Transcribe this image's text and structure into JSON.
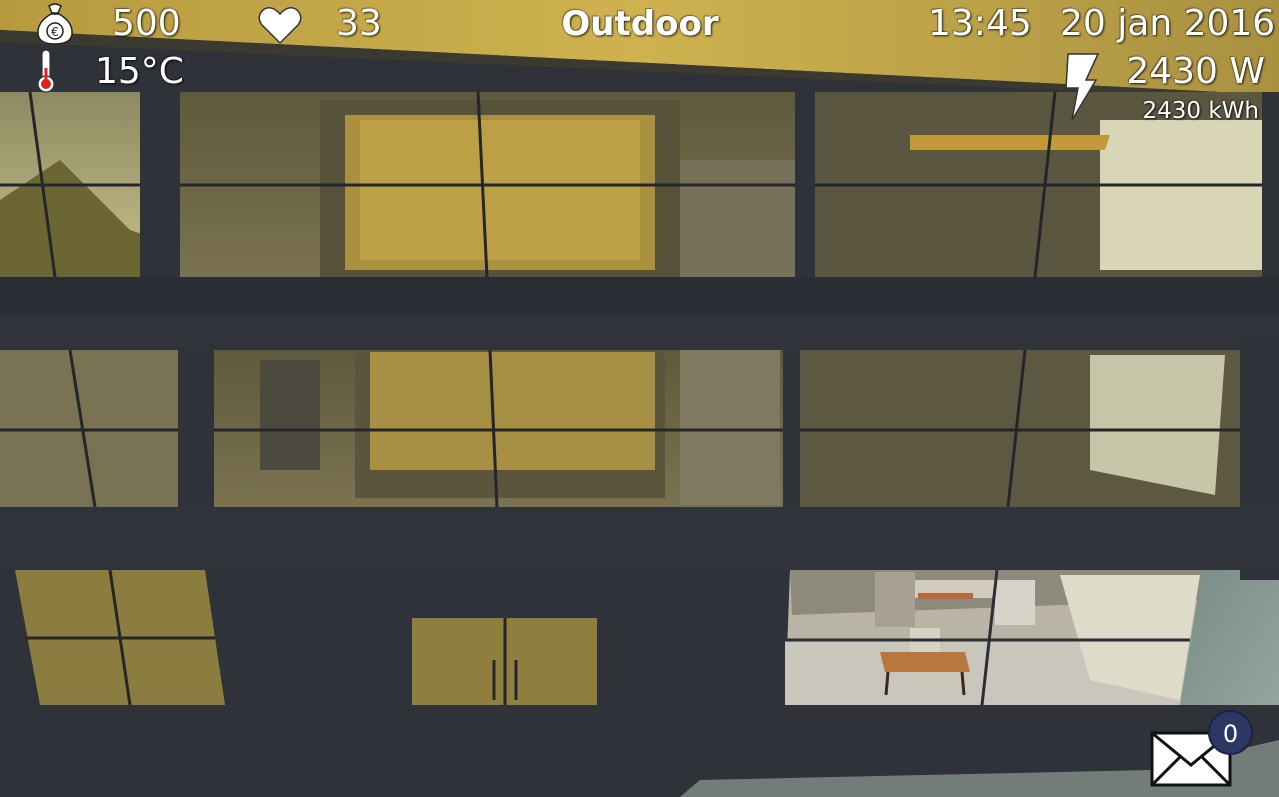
{
  "hud": {
    "money": "500",
    "health": "33",
    "location": "Outdoor",
    "time": "13:45",
    "date": "20 jan 2016",
    "temperature": "15°C",
    "power": "2430 W",
    "energy": "2430 kWh"
  },
  "messages": {
    "count": "0"
  },
  "icons": {
    "money": "money-bag-icon",
    "health": "heart-icon",
    "temperature": "thermometer-icon",
    "power": "lightning-icon",
    "mail": "envelope-icon"
  },
  "colors": {
    "facade": "#2f3238",
    "window_glow": "#c9a94a",
    "ground": "#9fb4a8"
  }
}
